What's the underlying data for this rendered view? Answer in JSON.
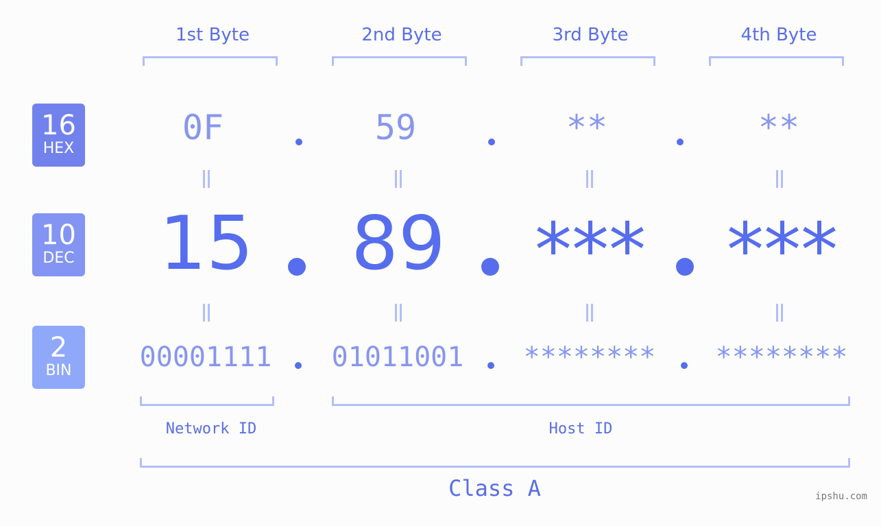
{
  "byte_headers": [
    "1st Byte",
    "2nd Byte",
    "3rd Byte",
    "4th Byte"
  ],
  "bases": [
    {
      "number": "16",
      "label": "HEX",
      "color": "#7282ec"
    },
    {
      "number": "10",
      "label": "DEC",
      "color": "#8394f2"
    },
    {
      "number": "2",
      "label": "BIN",
      "color": "#8fa8fa"
    }
  ],
  "hex_values": [
    "0F",
    "59",
    "**",
    "**"
  ],
  "dec_values": [
    "15",
    "89",
    "***",
    "***"
  ],
  "bin_values": [
    "00001111",
    "01011001",
    "********",
    "********"
  ],
  "segments": {
    "network_label": "Network ID",
    "host_label": "Host ID"
  },
  "class_label": "Class A",
  "watermark": "ipshu.com",
  "colors": {
    "primary": "#566ded",
    "light": "#8796ee",
    "bracket": "#b4bef8",
    "background": "#fbfcfb"
  }
}
